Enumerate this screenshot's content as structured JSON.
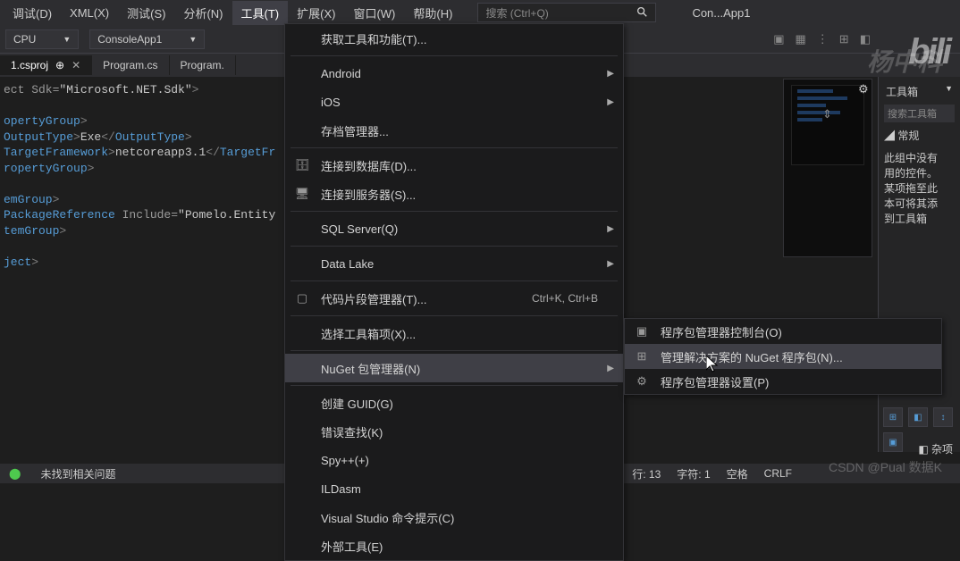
{
  "menubar": {
    "items": [
      {
        "label": "调试(D)"
      },
      {
        "label": "XML(X)"
      },
      {
        "label": "测试(S)"
      },
      {
        "label": "分析(N)"
      },
      {
        "label": "工具(T)",
        "active": true
      },
      {
        "label": "扩展(X)"
      },
      {
        "label": "窗口(W)"
      },
      {
        "label": "帮助(H)"
      }
    ],
    "search_placeholder": "搜索 (Ctrl+Q)",
    "app_title": "Con...App1"
  },
  "toolbar": {
    "cpu": "CPU",
    "project": "ConsoleApp1"
  },
  "tabs": [
    {
      "label": "1.csproj",
      "active": true,
      "pinned": true
    },
    {
      "label": "Program.cs",
      "active": false
    },
    {
      "label": "Program.",
      "active": false
    }
  ],
  "editor": {
    "lines": [
      {
        "pre": "ect Sdk=",
        "attr": "\"Microsoft.NET.Sdk\"",
        "post": ">"
      },
      {
        "text": ""
      },
      {
        "tag": "opertyGroup",
        "post": ">"
      },
      {
        "open": "OutputType",
        "inner": "Exe",
        "close": "OutputType"
      },
      {
        "open": "TargetFramework",
        "inner": "netcoreapp3.1",
        "close": "TargetF"
      },
      {
        "tag_close": "ropertyGroup",
        "post": ">"
      },
      {
        "text": ""
      },
      {
        "tag": "emGroup",
        "post": ">"
      },
      {
        "open": "PackageReference",
        "attr_name": " Include=",
        "attr_val": "\"Pomelo.Entity"
      },
      {
        "tag_close": "temGroup",
        "post": ">"
      },
      {
        "text": ""
      },
      {
        "tag_close": "ject",
        "post": ">"
      }
    ]
  },
  "tools_menu": [
    {
      "label": "获取工具和功能(T)...",
      "sep_after": true
    },
    {
      "label": "Android",
      "submenu": true
    },
    {
      "label": "iOS",
      "submenu": true
    },
    {
      "label": "存档管理器...",
      "sep_after": true
    },
    {
      "label": "连接到数据库(D)...",
      "icon": "db"
    },
    {
      "label": "连接到服务器(S)...",
      "icon": "server",
      "sep_after": true
    },
    {
      "label": "SQL Server(Q)",
      "submenu": true,
      "sep_after": true
    },
    {
      "label": "Data Lake",
      "submenu": true,
      "sep_after": true
    },
    {
      "label": "代码片段管理器(T)...",
      "icon": "snippet",
      "shortcut": "Ctrl+K, Ctrl+B",
      "sep_after": true
    },
    {
      "label": "选择工具箱项(X)...",
      "sep_after": true
    },
    {
      "label": "NuGet 包管理器(N)",
      "submenu": true,
      "hover": true,
      "sep_after": true
    },
    {
      "label": "创建 GUID(G)"
    },
    {
      "label": "错误查找(K)"
    },
    {
      "label": "Spy++(+)"
    },
    {
      "label": "ILDasm"
    },
    {
      "label": "Visual Studio 命令提示(C)"
    },
    {
      "label": "外部工具(E)"
    }
  ],
  "nuget_submenu": [
    {
      "label": "程序包管理器控制台(O)",
      "icon": "console"
    },
    {
      "label": "管理解决方案的 NuGet 程序包(N)...",
      "icon": "package",
      "hover": true
    },
    {
      "label": "程序包管理器设置(P)",
      "icon": "gear"
    }
  ],
  "toolbox": {
    "title": "工具箱",
    "search": "搜索工具箱",
    "group": "常规",
    "help_lines": [
      "此组中没有",
      "用的控件。",
      "某项拖至此",
      "本可将其添",
      "到工具箱"
    ]
  },
  "statusbar": {
    "issues": "未找到相关问题",
    "line": "行: 13",
    "chars": "字符: 1",
    "space": "空格",
    "crlf": "CRLF"
  },
  "misc": "杂项",
  "watermarks": {
    "name": "杨中科",
    "bili": "bili",
    "csdn": "CSDN @Pual 数据K"
  }
}
